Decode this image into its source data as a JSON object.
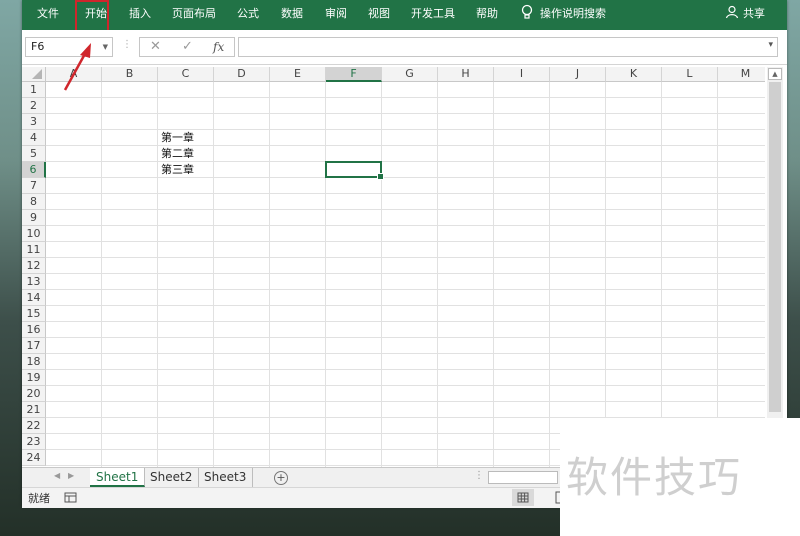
{
  "ribbon": {
    "tabs": [
      {
        "label": "文件"
      },
      {
        "label": "开始"
      },
      {
        "label": "插入"
      },
      {
        "label": "页面布局"
      },
      {
        "label": "公式"
      },
      {
        "label": "数据"
      },
      {
        "label": "审阅"
      },
      {
        "label": "视图"
      },
      {
        "label": "开发工具"
      },
      {
        "label": "帮助"
      }
    ],
    "tell_me": "操作说明搜索",
    "share": "共享",
    "highlighted_tab": "开始"
  },
  "formula_bar": {
    "name_box": "F6",
    "cancel_icon": "✕",
    "enter_icon": "✓",
    "fx_label": "fx",
    "value": ""
  },
  "columns": [
    "A",
    "B",
    "C",
    "D",
    "E",
    "F",
    "G",
    "H",
    "I",
    "J",
    "K",
    "L",
    "M"
  ],
  "rows": [
    "1",
    "2",
    "3",
    "4",
    "5",
    "6",
    "7",
    "8",
    "9",
    "10",
    "11",
    "12",
    "13",
    "14",
    "15",
    "16",
    "17",
    "18",
    "19",
    "20",
    "21",
    "22",
    "23",
    "24"
  ],
  "cells": {
    "C4": "第一章",
    "C5": "第二章",
    "C6": "第三章"
  },
  "active_cell": "F6",
  "sheets": [
    {
      "label": "Sheet1",
      "active": true
    },
    {
      "label": "Sheet2",
      "active": false
    },
    {
      "label": "Sheet3",
      "active": false
    }
  ],
  "status": {
    "text": "就绪"
  },
  "watermark": "软件技巧",
  "colors": {
    "accent": "#217346",
    "highlight": "#d0262c"
  }
}
